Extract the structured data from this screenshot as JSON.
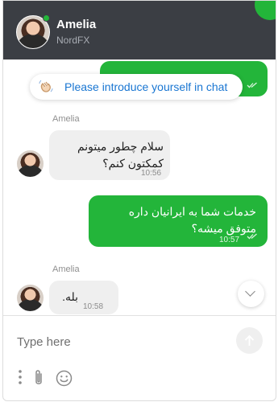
{
  "header": {
    "agent_name": "Amelia",
    "company": "NordFX"
  },
  "prompt": {
    "text": "Please introduce yourself in chat",
    "icon": "waving-hand-icon"
  },
  "messages": [
    {
      "direction": "in",
      "sender": "Amelia",
      "text": "سلام چطور میتونم کمکتون کنم؟",
      "time": "10:56"
    },
    {
      "direction": "out",
      "text": "خدمات شما به ایرانیان داره متوفق میشه؟",
      "time": "10:57"
    },
    {
      "direction": "in",
      "sender": "Amelia",
      "text": "بله.",
      "time": "10:58"
    }
  ],
  "composer": {
    "placeholder": "Type here"
  },
  "colors": {
    "accent": "#23b53a",
    "header_bg": "#3b3e44",
    "link": "#1976d2"
  }
}
